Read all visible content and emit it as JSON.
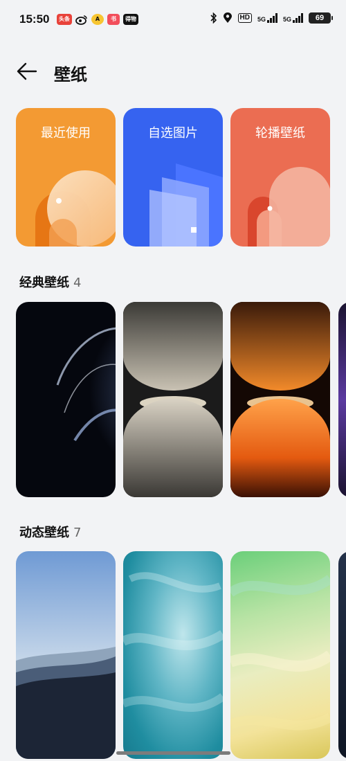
{
  "status_bar": {
    "time": "15:50",
    "apps": [
      {
        "name": "toutiao-icon",
        "label": "头条",
        "color": "#e8423a"
      },
      {
        "name": "weibo-icon",
        "label": "微",
        "color": "#ffffff"
      },
      {
        "name": "app-a-icon",
        "label": "A",
        "color": "#f7c531"
      },
      {
        "name": "xiaohongshu-icon",
        "label": "书",
        "color": "#f24e5b"
      },
      {
        "name": "app-dewu-icon",
        "label": "得物",
        "color": "#111111"
      }
    ],
    "hd": "HD",
    "net1": "5G",
    "net2": "5G",
    "battery": "69"
  },
  "header": {
    "title": "壁纸"
  },
  "categories": [
    {
      "label": "最近使用",
      "color": "#f39a33"
    },
    {
      "label": "自选图片",
      "color": "#3663f0"
    },
    {
      "label": "轮播壁纸",
      "color": "#eb6d52"
    }
  ],
  "classic": {
    "title": "经典壁纸",
    "count": "4"
  },
  "dynamic": {
    "title": "动态壁纸",
    "count": "7"
  }
}
